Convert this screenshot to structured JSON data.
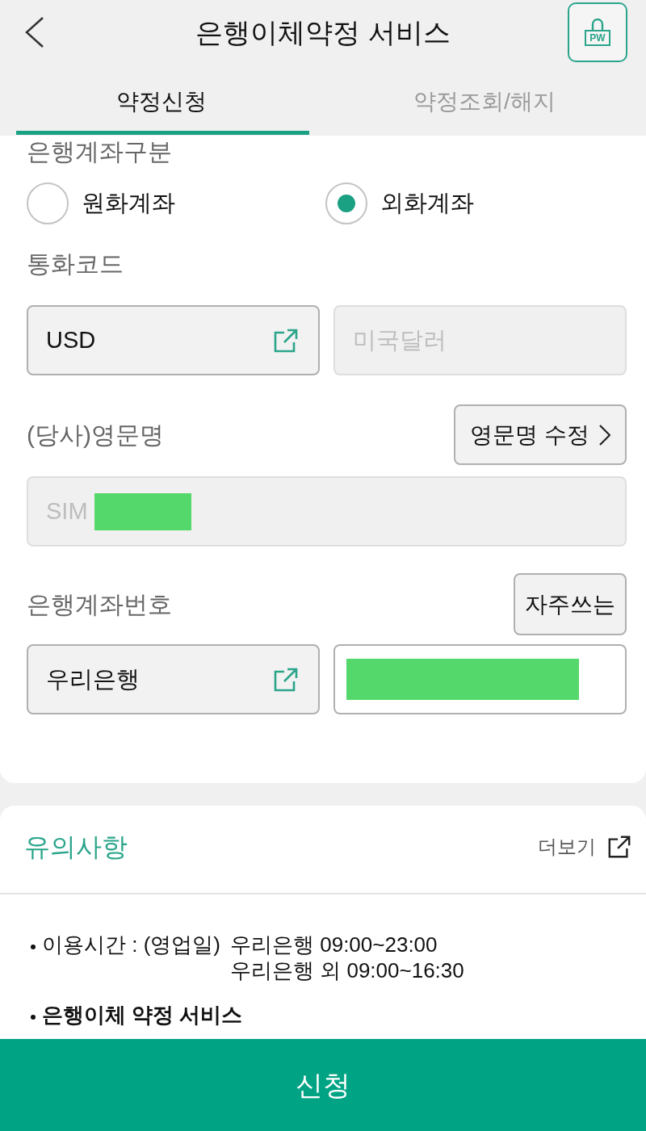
{
  "header": {
    "title": "은행이체약정 서비스",
    "lock_button": {
      "label": "PW"
    }
  },
  "tabs": [
    {
      "label": "약정신청",
      "selected": true
    },
    {
      "label": "약정조회/해지",
      "selected": false
    }
  ],
  "form": {
    "account_type": {
      "label": "은행계좌구분",
      "options": [
        {
          "label": "원화계좌",
          "selected": false
        },
        {
          "label": "외화계좌",
          "selected": true
        }
      ]
    },
    "currency": {
      "label": "통화코드",
      "fields": [
        {
          "kind": "picker",
          "value": "USD"
        },
        {
          "kind": "readonly",
          "value": "미국달러"
        }
      ]
    },
    "english_name": {
      "label": "(당사)영문명",
      "button": {
        "label": "영문명 수정",
        "chevron": true
      },
      "fields": [
        {
          "kind": "readonly",
          "value": "SIM",
          "redacted": true
        }
      ]
    },
    "bank_account": {
      "label": "은행계좌번호",
      "button": {
        "label": "자주쓰는"
      },
      "fields": [
        {
          "kind": "picker",
          "value": "우리은행"
        },
        {
          "kind": "input",
          "redacted": true
        }
      ]
    }
  },
  "notice": {
    "title": "유의사항",
    "more_link": "더보기",
    "items": [
      {
        "kind": "hours",
        "label": "이용시간 : (영업일)",
        "lines": [
          "우리은행 09:00~23:00",
          "우리은행 외 09:00~16:30"
        ]
      },
      {
        "kind": "heading",
        "text": "은행이체 약정 서비스"
      }
    ]
  },
  "submit_button": "신청"
}
